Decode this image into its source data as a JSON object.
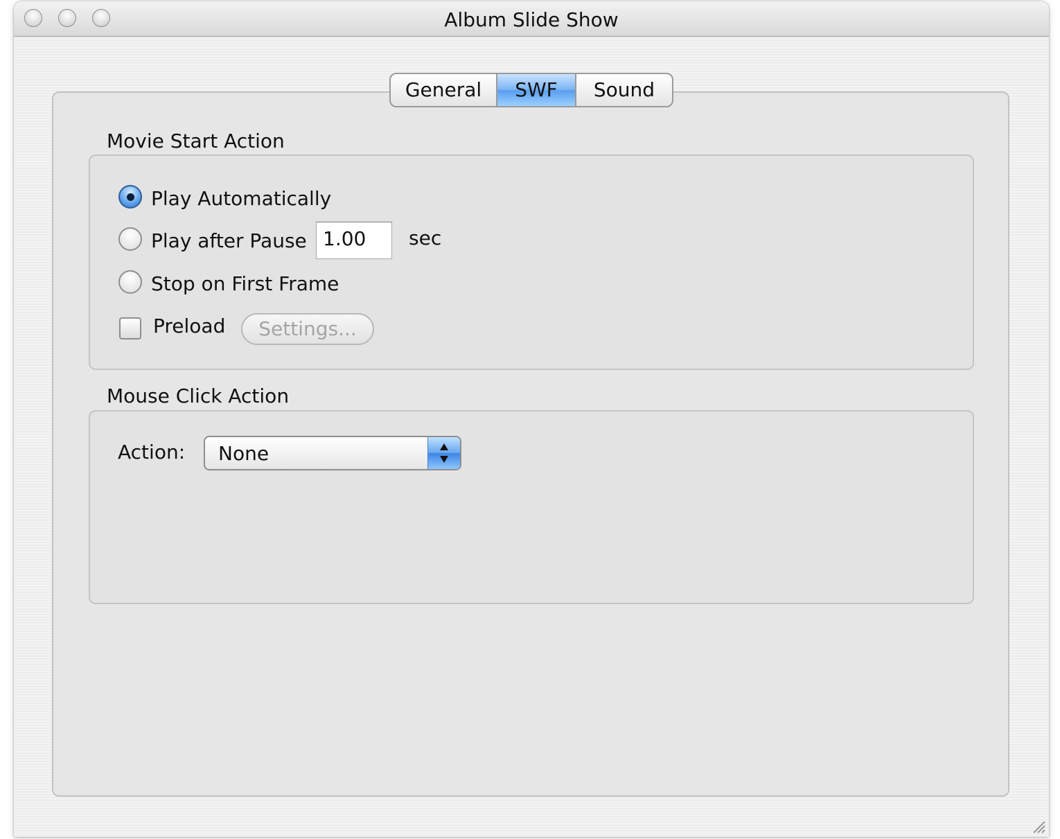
{
  "window": {
    "title": "Album Slide Show"
  },
  "tabs": [
    {
      "label": "General",
      "selected": false
    },
    {
      "label": "SWF",
      "selected": true
    },
    {
      "label": "Sound",
      "selected": false
    }
  ],
  "movie_start": {
    "group_label": "Movie Start Action",
    "options": [
      {
        "label": "Play Automatically",
        "checked": true
      },
      {
        "label": "Play after Pause",
        "checked": false
      },
      {
        "label": "Stop on First Frame",
        "checked": false
      }
    ],
    "pause_value": "1.00",
    "pause_unit": "sec",
    "preload_label": "Preload",
    "preload_checked": false,
    "settings_button": "Settings..."
  },
  "mouse_click": {
    "group_label": "Mouse Click Action",
    "action_label": "Action:",
    "action_value": "None"
  },
  "colors": {
    "selected_tab": "#7db5f3",
    "radio_selected": "#2b6fd0",
    "disabled_text": "#a5a5a5"
  },
  "icons": [
    "close-button",
    "minimize-button",
    "zoom-button",
    "popup-arrows-icon",
    "resize-grip-icon"
  ]
}
